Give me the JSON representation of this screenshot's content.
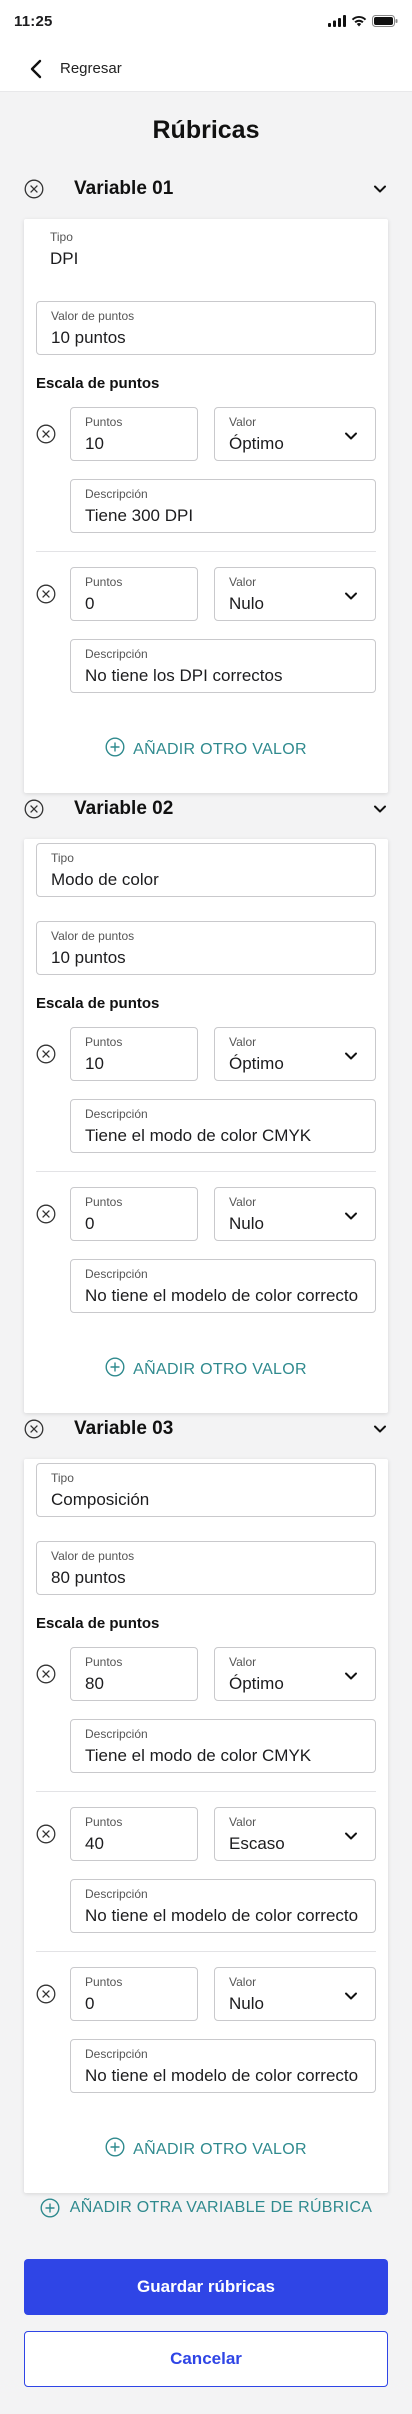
{
  "status_bar": {
    "time": "11:25",
    "icons": [
      "signal-icon",
      "wifi-icon",
      "battery-icon"
    ]
  },
  "nav": {
    "back_label": "Regresar",
    "back_icon": "chevron-left-icon"
  },
  "page": {
    "title": "Rúbricas"
  },
  "labels": {
    "tipo": "Tipo",
    "valor_puntos": "Valor de puntos",
    "escala": "Escala de puntos",
    "puntos": "Puntos",
    "valor": "Valor",
    "descripcion": "Descripción",
    "add_value": "AÑADIR OTRO VALOR"
  },
  "variables": [
    {
      "title": "Variable 01",
      "tipo": "DPI",
      "valor_puntos": "10 puntos",
      "scale": [
        {
          "puntos": "10",
          "valor": "Óptimo",
          "descripcion": "Tiene 300 DPI"
        },
        {
          "puntos": "0",
          "valor": "Nulo",
          "descripcion": "No tiene los DPI correctos"
        }
      ]
    },
    {
      "title": "Variable 02",
      "tipo": "Modo de color",
      "valor_puntos": "10 puntos",
      "scale": [
        {
          "puntos": "10",
          "valor": "Óptimo",
          "descripcion": "Tiene el modo de color CMYK"
        },
        {
          "puntos": "0",
          "valor": "Nulo",
          "descripcion": "No tiene el modelo de color correcto"
        }
      ]
    },
    {
      "title": "Variable 03",
      "tipo": "Composición",
      "valor_puntos": "80 puntos",
      "scale": [
        {
          "puntos": "80",
          "valor": "Óptimo",
          "descripcion": "Tiene el modo de color CMYK"
        },
        {
          "puntos": "40",
          "valor": "Escaso",
          "descripcion": "No tiene el modelo de color correcto"
        },
        {
          "puntos": "0",
          "valor": "Nulo",
          "descripcion": "No tiene el modelo de color correcto"
        }
      ]
    }
  ],
  "add_variable": "AÑADIR OTRA VARIABLE DE RÚBRICA",
  "buttons": {
    "save": "Guardar rúbricas",
    "cancel": "Cancelar"
  },
  "colors": {
    "primary": "#2f45e6",
    "accent": "#2f8a8e",
    "background": "#f3f3f4"
  }
}
